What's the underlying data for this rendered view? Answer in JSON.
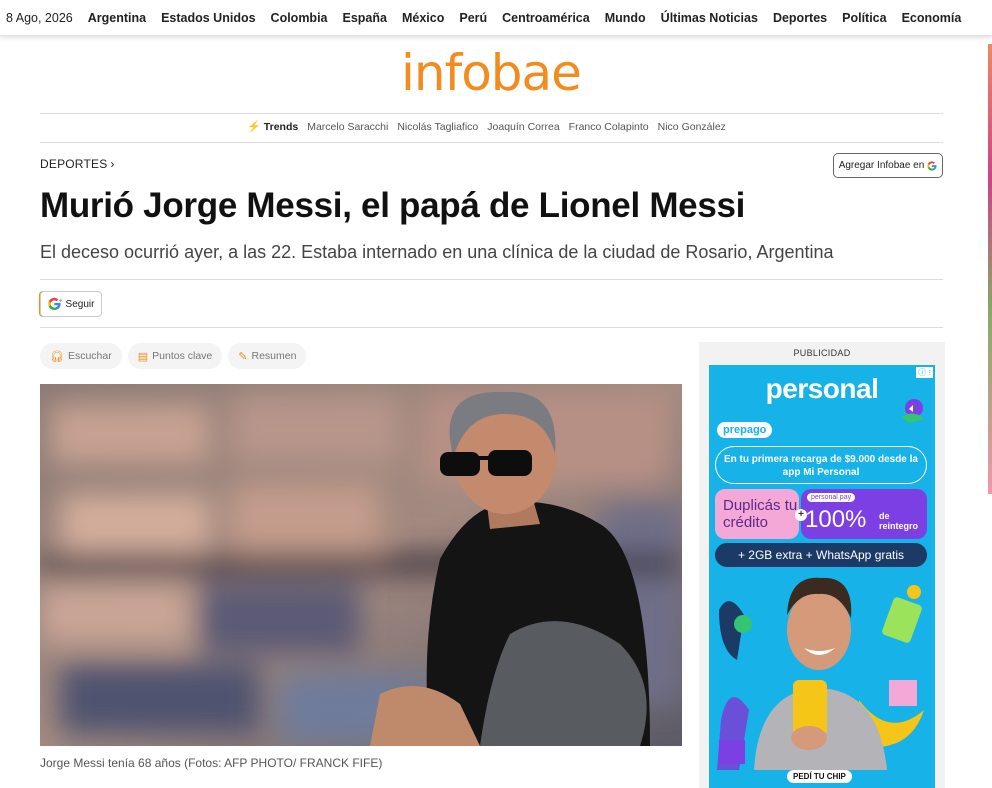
{
  "topnav": {
    "date": "8 Ago, 2026",
    "links": [
      "Argentina",
      "Estados Unidos",
      "Colombia",
      "España",
      "México",
      "Perú",
      "Centroamérica",
      "Mundo",
      "Últimas Noticias",
      "Deportes",
      "Política",
      "Economía"
    ]
  },
  "logo": "infobae",
  "trends": {
    "label": "Trends",
    "items": [
      "Marcelo Saracchi",
      "Nicolás Tagliafico",
      "Joaquín Correa",
      "Franco Colapinto",
      "Nico González"
    ]
  },
  "article": {
    "section": "DEPORTES",
    "add_button": "Agregar Infobae en",
    "headline": "Murió Jorge Messi, el papá de Lionel Messi",
    "subheadline": "El deceso ocurrió ayer, a las 22. Estaba internado en una clínica de la ciudad de Rosario, Argentina",
    "follow_button": "Seguir",
    "tools": [
      "Escuchar",
      "Puntos clave",
      "Resumen"
    ],
    "caption": "Jorge Messi tenía 68 años (Fotos: AFP PHOTO/ FRANCK FIFE)"
  },
  "ad": {
    "label": "PUBLICIDAD",
    "brand": "personal",
    "badge": "prepago",
    "recarga": "En tu primera recarga de $9.000 desde la app Mi Personal",
    "duplicas": "Duplicás tu crédito",
    "personal_pay": "personal pay",
    "percent": "100%",
    "de_reintegro": "de reintegro",
    "gb": "+ 2GB extra + WhatsApp gratis",
    "chip": "PEDÍ TU CHIP"
  },
  "colors": {
    "brand": "#f28c1f",
    "ad_blue": "#17b2e7"
  }
}
